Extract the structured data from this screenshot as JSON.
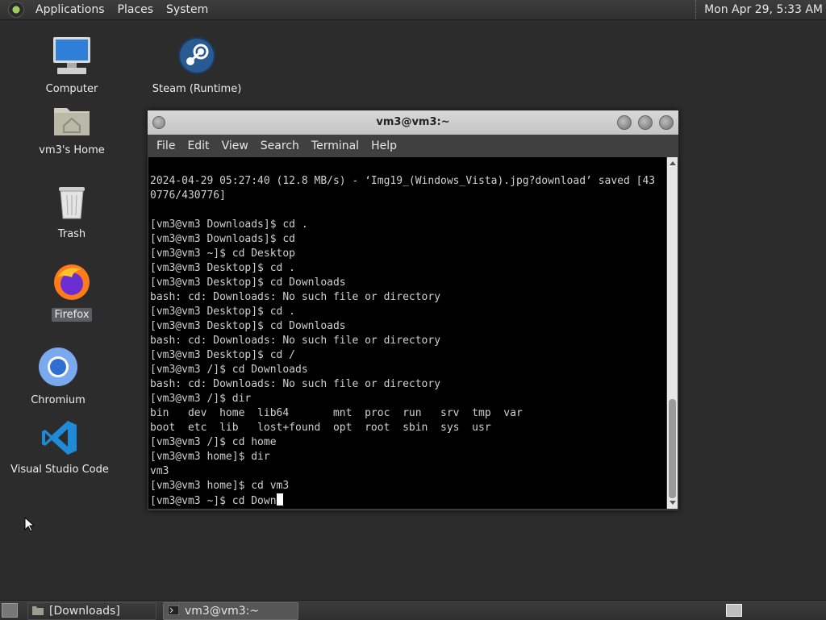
{
  "top_panel": {
    "menus": [
      "Applications",
      "Places",
      "System"
    ],
    "clock": "Mon Apr 29,  5:33 AM"
  },
  "desktop": {
    "icons": [
      {
        "label": "Computer",
        "icon": "computer-icon"
      },
      {
        "label": "Steam (Runtime)",
        "icon": "steam-icon"
      },
      {
        "label": "vm3's Home",
        "icon": "home-folder-icon"
      },
      {
        "label": "Trash",
        "icon": "trash-icon"
      },
      {
        "label": "Firefox",
        "icon": "firefox-icon"
      },
      {
        "label": "Chromium",
        "icon": "chromium-icon"
      },
      {
        "label": "Visual Studio Code",
        "icon": "vscode-icon"
      }
    ]
  },
  "window": {
    "title": "vm3@vm3:~",
    "menu": [
      "File",
      "Edit",
      "View",
      "Search",
      "Terminal",
      "Help"
    ],
    "terminal_text": "2024-04-29 05:27:40 (12.8 MB/s) - ‘Img19_(Windows_Vista).jpg?download’ saved [43\n0776/430776]\n\n[vm3@vm3 Downloads]$ cd .\n[vm3@vm3 Downloads]$ cd\n[vm3@vm3 ~]$ cd Desktop\n[vm3@vm3 Desktop]$ cd .\n[vm3@vm3 Desktop]$ cd Downloads\nbash: cd: Downloads: No such file or directory\n[vm3@vm3 Desktop]$ cd .\n[vm3@vm3 Desktop]$ cd Downloads\nbash: cd: Downloads: No such file or directory\n[vm3@vm3 Desktop]$ cd /\n[vm3@vm3 /]$ cd Downloads\nbash: cd: Downloads: No such file or directory\n[vm3@vm3 /]$ dir\nbin   dev  home  lib64       mnt  proc  run   srv  tmp  var\nboot  etc  lib   lost+found  opt  root  sbin  sys  usr\n[vm3@vm3 /]$ cd home\n[vm3@vm3 home]$ dir\nvm3\n[vm3@vm3 home]$ cd vm3\n",
    "prompt_line": "[vm3@vm3 ~]$ cd Down"
  },
  "taskbar": {
    "tasks": [
      "[Downloads]",
      "vm3@vm3:~"
    ]
  }
}
